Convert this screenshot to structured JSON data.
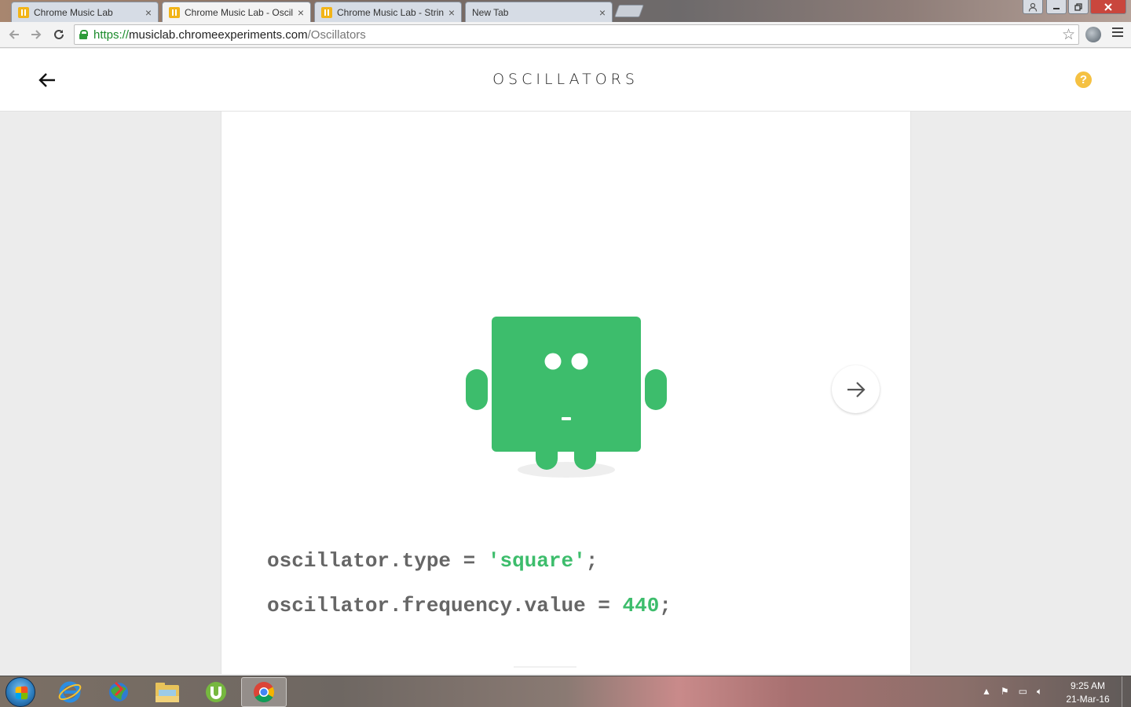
{
  "browser": {
    "tabs": [
      {
        "title": "Chrome Music Lab",
        "active": false
      },
      {
        "title": "Chrome Music Lab - Oscil",
        "active": true
      },
      {
        "title": "Chrome Music Lab - Strin",
        "active": false
      },
      {
        "title": "New Tab",
        "active": false
      }
    ],
    "close_glyph": "×",
    "url": {
      "scheme": "https://",
      "host": "musiclab.chromeexperiments.com",
      "path": "/Oscillators"
    }
  },
  "page": {
    "title": "OSCILLATORS",
    "help_label": "?",
    "code": {
      "line1": {
        "prefix": "oscillator.type = ",
        "value": "'square'",
        "suffix": ";"
      },
      "line2": {
        "prefix": "oscillator.frequency.value = ",
        "value": "440",
        "suffix": ";"
      }
    },
    "colors": {
      "accent_green": "#3dbd6c",
      "help_yellow": "#f5c142"
    }
  },
  "taskbar": {
    "time": "9:25 AM",
    "date": "21-Mar-16",
    "apps": [
      "internet-explorer-icon",
      "downloader-icon",
      "file-explorer-icon",
      "utorrent-icon",
      "chrome-icon"
    ]
  }
}
